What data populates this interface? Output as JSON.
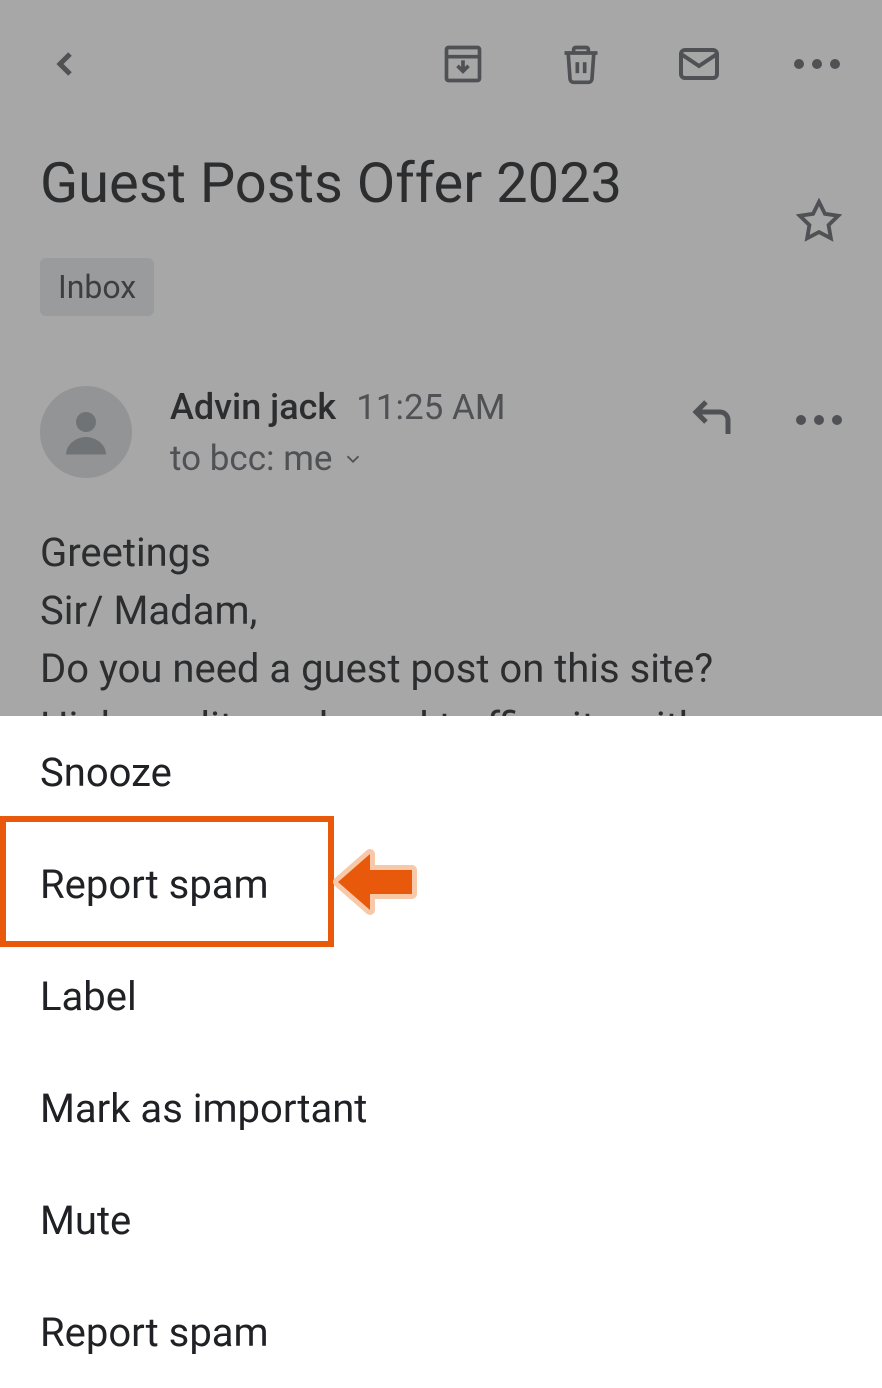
{
  "header": {
    "icons": {
      "back": "back",
      "archive": "archive",
      "delete": "delete",
      "mark_unread": "mark-unread",
      "more": "more"
    }
  },
  "subject": "Guest Posts Offer 2023",
  "label": "Inbox",
  "sender": {
    "name": "Advin jack",
    "time": "11:25 AM",
    "to_line": "to bcc: me"
  },
  "body": {
    "line1": "Greetings",
    "line2": " Sir/ Madam,",
    "line3": "Do you need a guest post on this site?",
    "line4": "High-quality and good traffic site with a"
  },
  "menu": {
    "items": [
      "Snooze",
      "Report spam",
      "Label",
      "Mark as important",
      "Mute",
      "Report spam"
    ],
    "highlighted_index": 1
  },
  "annotation": {
    "highlight_color": "#e8590c"
  }
}
